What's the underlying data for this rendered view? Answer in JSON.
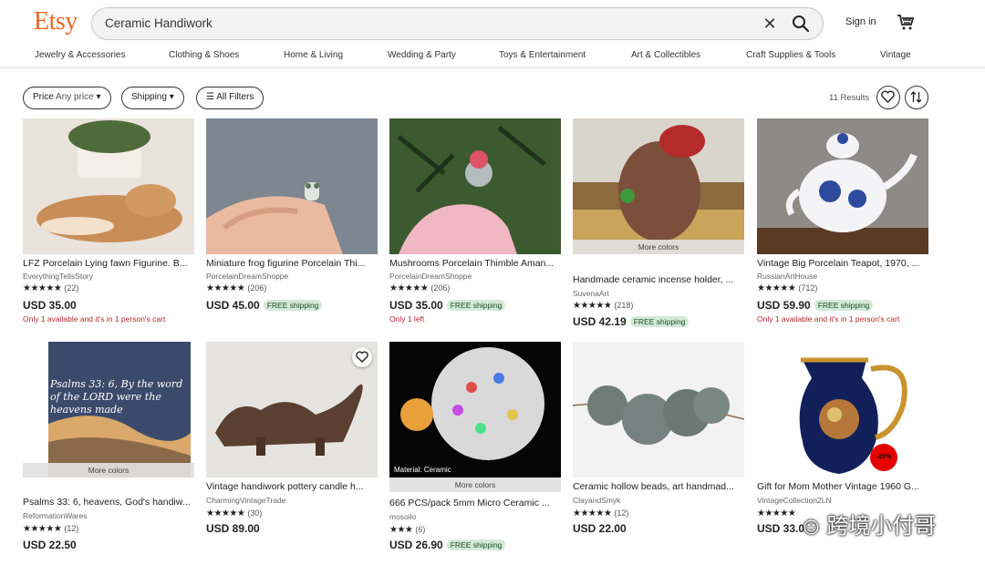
{
  "header": {
    "logo": "Etsy",
    "search_value": "Ceramic Handiwork",
    "clear_glyph": "✕",
    "signin": "Sign in",
    "icons": [
      "search-icon",
      "cart-icon",
      "close-icon"
    ]
  },
  "categories": [
    "Jewelry & Accessories",
    "Clothing & Shoes",
    "Home & Living",
    "Wedding & Party",
    "Toys & Entertainment",
    "Art & Collectibles",
    "Craft Supplies & Tools",
    "Vintage"
  ],
  "filters": {
    "price_label": "Price",
    "price_value": "Any price",
    "shipping": "Shipping",
    "all_filters": "All Filters",
    "results": "11 Results"
  },
  "products": [
    {
      "title": "LFZ Porcelain Lying fawn Figurine. B...",
      "shop": "EverythingTellsStory",
      "stars": "★★★★★",
      "reviews": "(22)",
      "price": "USD 35.00",
      "free_shipping": "",
      "note": "Only 1 available and it's in 1 person's cart",
      "more_colors": ""
    },
    {
      "title": "Miniature frog figurine Porcelain Thi...",
      "shop": "PorcelainDreamShoppe",
      "stars": "★★★★★",
      "reviews": "(206)",
      "price": "USD 45.00",
      "free_shipping": "FREE shipping",
      "note": "",
      "more_colors": ""
    },
    {
      "title": "Mushrooms Porcelain Thimble Aman...",
      "shop": "PorcelainDreamShoppe",
      "stars": "★★★★★",
      "reviews": "(206)",
      "price": "USD 35.00",
      "free_shipping": "FREE shipping",
      "note": "Only 1 left",
      "more_colors": ""
    },
    {
      "title": "Handmade ceramic incense holder, ...",
      "shop": "SuvenaArt",
      "stars": "★★★★★",
      "reviews": "(218)",
      "price": "USD 42.19",
      "free_shipping": "FREE shipping",
      "note": "",
      "more_colors": "More colors"
    },
    {
      "title": "Vintage Big Porcelain Teapot, 1970, ...",
      "shop": "RussianArtHouse",
      "stars": "★★★★★",
      "reviews": "(712)",
      "price": "USD 59.90",
      "free_shipping": "FREE shipping",
      "note": "Only 1 available and it's in 1 person's cart",
      "more_colors": ""
    },
    {
      "title": "Psalms 33: 6, heavens, God's handiw...",
      "shop": "ReformationWares",
      "stars": "★★★★★",
      "reviews": "(12)",
      "price": "USD 22.50",
      "free_shipping": "",
      "note": "",
      "more_colors": "More colors",
      "image_text": "Psalms 33: 6, By the word of the LORD were the heavens made"
    },
    {
      "title": "Vintage handiwork pottery candle h...",
      "shop": "CharmingVintageTrade",
      "stars": "★★★★★",
      "reviews": "(30)",
      "price": "USD 89.00",
      "free_shipping": "",
      "note": "",
      "more_colors": ""
    },
    {
      "title": "666 PCS/pack 5mm Micro Ceramic ...",
      "shop": "mosoilo",
      "stars": "★★★",
      "reviews": "(6)",
      "price": "USD 26.90",
      "free_shipping": "FREE shipping",
      "note": "",
      "more_colors": "More colors",
      "image_text": "Material: Ceramic"
    },
    {
      "title": "Ceramic hollow beads, art handmad...",
      "shop": "ClayandSmyk",
      "stars": "★★★★★",
      "reviews": "(12)",
      "price": "USD 22.00",
      "free_shipping": "",
      "note": "",
      "more_colors": ""
    },
    {
      "title": "Gift for Mom Mother Vintage 1960 G...",
      "shop": "VintageCollection2LN",
      "stars": "★★★★★",
      "reviews": "",
      "price": "USD 33.0",
      "free_shipping": "",
      "note": "",
      "more_colors": "",
      "image_text": "-20%"
    }
  ],
  "watermark": "跨境小付哥",
  "colors": {
    "brand": "#f1641e",
    "free_bg": "#d4e9d7",
    "note_red": "#b5282e"
  }
}
